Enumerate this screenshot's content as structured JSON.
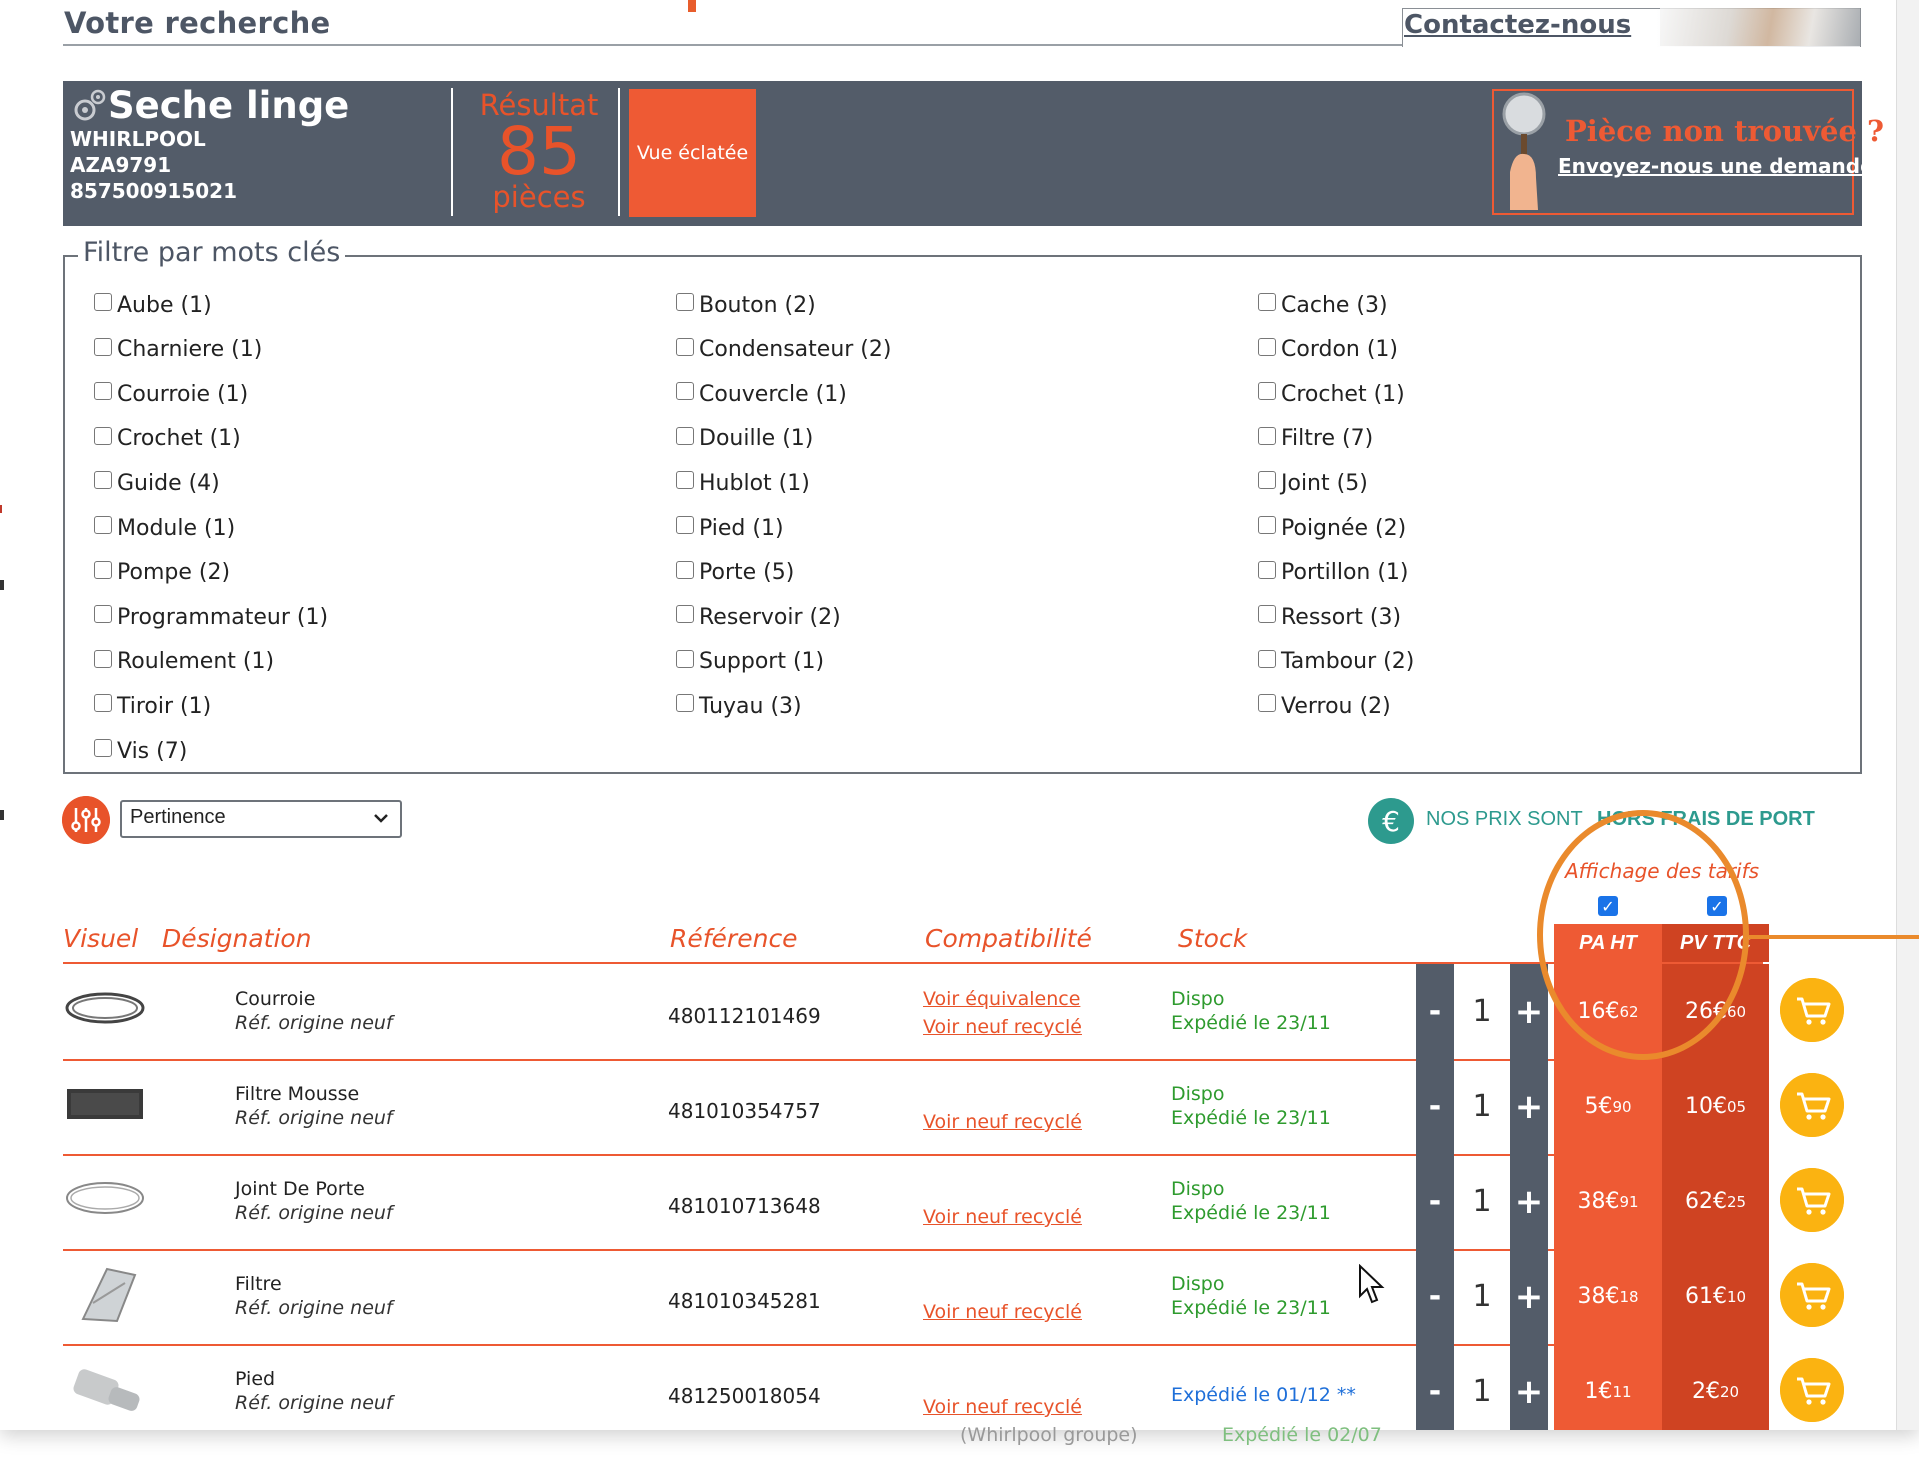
{
  "header": {
    "search_title": "Votre recherche",
    "contact_label": "Contactez-nous"
  },
  "product": {
    "appliance": "Seche linge",
    "brand": "WHIRLPOOL",
    "model": "AZA9791",
    "ean": "857500915021"
  },
  "result": {
    "label": "Résultat",
    "count": "85",
    "unit": "pièces"
  },
  "vue_button": "Vue éclatée",
  "not_found": {
    "title": "Pièce non trouvée ?",
    "link": "Envoyez-nous une demande"
  },
  "filter": {
    "legend": "Filtre par mots clés",
    "columns": [
      [
        "Aube (1)",
        "Charniere (1)",
        "Courroie (1)",
        "Crochet (1)",
        "Guide (4)",
        "Module (1)",
        "Pompe (2)",
        "Programmateur (1)",
        "Roulement (1)",
        "Tiroir (1)",
        "Vis (7)"
      ],
      [
        "Bouton (2)",
        "Condensateur (2)",
        "Couvercle (1)",
        "Douille (1)",
        "Hublot (1)",
        "Pied (1)",
        "Porte (5)",
        "Reservoir (2)",
        "Support (1)",
        "Tuyau (3)"
      ],
      [
        "Cache (3)",
        "Cordon (1)",
        "Crochet (1)",
        "Filtre (7)",
        "Joint (5)",
        "Poignée (2)",
        "Portillon (1)",
        "Ressort (3)",
        "Tambour (2)",
        "Verrou (2)"
      ]
    ]
  },
  "sort": {
    "selected": "Pertinence"
  },
  "shipping_notice": {
    "prefix": "NOS PRIX SONT",
    "strong": "HORS FRAIS DE PORT"
  },
  "pricing_toggle": {
    "label": "Affichage des tarifs",
    "pa_label": "PA HT",
    "pv_label": "PV TTC",
    "pa_checked": true,
    "pv_checked": true
  },
  "table": {
    "headers": {
      "visuel": "Visuel",
      "designation": "Désignation",
      "reference": "Référence",
      "compatibilite": "Compatibilité",
      "stock": "Stock"
    },
    "rows": [
      {
        "name": "Courroie",
        "origin": "Réf. origine neuf",
        "ref": "480112101469",
        "equiv": "Voir équivalence",
        "recycle": "Voir neuf recyclé",
        "stock_status": "Dispo",
        "stock_ship": "Expédié le 23/11",
        "qty": "1",
        "pa_int": "16€",
        "pa_dec": "62",
        "pv_int": "26€",
        "pv_dec": "60"
      },
      {
        "name": "Filtre Mousse",
        "origin": "Réf. origine neuf",
        "ref": "481010354757",
        "equiv": "",
        "recycle": "Voir neuf recyclé",
        "stock_status": "Dispo",
        "stock_ship": "Expédié le 23/11",
        "qty": "1",
        "pa_int": "5€",
        "pa_dec": "90",
        "pv_int": "10€",
        "pv_dec": "05"
      },
      {
        "name": "Joint De Porte",
        "origin": "Réf. origine neuf",
        "ref": "481010713648",
        "equiv": "",
        "recycle": "Voir neuf recyclé",
        "stock_status": "Dispo",
        "stock_ship": "Expédié le 23/11",
        "qty": "1",
        "pa_int": "38€",
        "pa_dec": "91",
        "pv_int": "62€",
        "pv_dec": "25"
      },
      {
        "name": "Filtre",
        "origin": "Réf. origine neuf",
        "ref": "481010345281",
        "equiv": "",
        "recycle": "Voir neuf recyclé",
        "stock_status": "Dispo",
        "stock_ship": "Expédié le 23/11",
        "qty": "1",
        "pa_int": "38€",
        "pa_dec": "18",
        "pv_int": "61€",
        "pv_dec": "10"
      },
      {
        "name": "Pied",
        "origin": "Réf. origine neuf",
        "ref": "481250018054",
        "equiv": "",
        "recycle": "Voir neuf recyclé",
        "stock_status": "",
        "stock_ship": "Expédié le 01/12 **",
        "qty": "1",
        "pa_int": "1€",
        "pa_dec": "11",
        "pv_int": "2€",
        "pv_dec": "20"
      }
    ],
    "ghost_row": {
      "compat_note": "(Whirlpool groupe)",
      "stock_note": "Expédié le 02/07"
    }
  },
  "colors": {
    "banner": "#535c69",
    "accent": "#ee5a34",
    "pv_column": "#cf4322",
    "cart": "#fbb311",
    "stock_ok": "#2e9b2e",
    "stock_later": "#1e6fd9",
    "highlight": "#ea8a2c"
  },
  "icons": {
    "gear": "gear-icon",
    "magnifier": "magnifier-icon",
    "sort": "sort-settings-icon",
    "euro": "euro-icon",
    "cart": "cart-icon",
    "cursor": "mouse-cursor-icon"
  }
}
